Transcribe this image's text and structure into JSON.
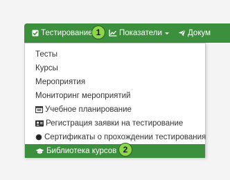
{
  "navbar": {
    "items": [
      {
        "label": "Тестирование",
        "icon": "checkbox-icon"
      },
      {
        "label": "Показатели",
        "icon": "line-chart-icon"
      },
      {
        "label": "Докум",
        "icon": "paper-plane-icon"
      }
    ],
    "color": "#3c8f3c"
  },
  "badges": {
    "first": "1",
    "second": "2",
    "color": "#8bd64a"
  },
  "dropdown": {
    "items": [
      {
        "label": "Тесты"
      },
      {
        "label": "Курсы"
      },
      {
        "label": "Мероприятия"
      },
      {
        "label": "Мониторинг мероприятий"
      },
      {
        "label": "Учебное планирование",
        "icon": "calendar-icon"
      },
      {
        "label": "Регистрация заявки на тестирование",
        "icon": "id-card-icon"
      },
      {
        "label": "Сертификаты о прохождении тестирования",
        "icon": "certificate-icon"
      },
      {
        "label": "Библиотека курсов",
        "icon": "graduation-cap-icon",
        "active": true
      }
    ]
  }
}
